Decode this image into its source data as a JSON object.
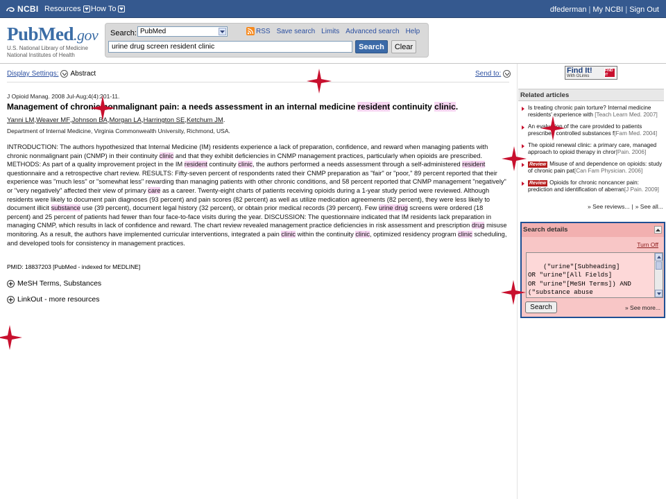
{
  "ncbi": {
    "logo": "NCBI",
    "menu": [
      {
        "label": "Resources"
      },
      {
        "label": "How To"
      }
    ],
    "user": "dfederman",
    "my_ncbi": "My NCBI",
    "sign_out": "Sign Out",
    "separator": "|"
  },
  "header": {
    "logo_main": "PubMed",
    "logo_gov": ".gov",
    "logo_line1": "U.S. National Library of Medicine",
    "logo_line2": "National Institutes of Health",
    "search_label": "Search:",
    "database": "PubMed",
    "links": [
      "RSS",
      "Save search",
      "Limits",
      "Advanced search",
      "Help"
    ],
    "query": "urine drug screen resident clinic",
    "search_button": "Search",
    "clear_button": "Clear"
  },
  "display": {
    "settings_label": "Display Settings:",
    "format": "Abstract",
    "send_to": "Send to:"
  },
  "article": {
    "citation": "J Opioid Manag. 2008 Jul-Aug;4(4):201-11.",
    "title_parts": [
      {
        "text": "Management of chronic nonmalignant pain: a needs assessment in an internal medicine ",
        "hl": false
      },
      {
        "text": "resident",
        "hl": true
      },
      {
        "text": " continuity ",
        "hl": false
      },
      {
        "text": "clinic",
        "hl": true
      },
      {
        "text": ".",
        "hl": false
      }
    ],
    "authors": [
      "Yanni LM",
      "Weaver MF",
      "Johnson BA",
      "Morgan LA",
      "Harrington SE",
      "Ketchum JM"
    ],
    "affiliation": "Department of Internal Medicine, Virginia Commonwealth University, Richmond, USA.",
    "abstract_parts": [
      {
        "text": "INTRODUCTION: The authors hypothesized that Internal Medicine (IM) residents experience a lack of preparation, confidence, and reward when managing patients with chronic nonmalignant pain (CNMP) in their continuity ",
        "hl": false
      },
      {
        "text": "clinic",
        "hl": true
      },
      {
        "text": " and that they exhibit deficiencies in CNMP management practices, particularly when opioids are prescribed. METHODS: As part of a quality improvement project in the IM ",
        "hl": false
      },
      {
        "text": "resident",
        "hl": true
      },
      {
        "text": " continuity ",
        "hl": false
      },
      {
        "text": "clinic",
        "hl": true
      },
      {
        "text": ", the authors performed a needs assessment through a self-administered ",
        "hl": false
      },
      {
        "text": "resident",
        "hl": true
      },
      {
        "text": " questionnaire and a retrospective chart review. RESULTS: Fifty-seven percent of respondents rated their CNMP preparation as \"fair\" or \"poor,\" 89 percent reported that their experience was \"much less\" or \"somewhat less\" rewarding than managing patients with other chronic conditions, and 58 percent reported that CNMP management \"negatively\" or \"very negatively\" affected their view of primary ",
        "hl": false
      },
      {
        "text": "care",
        "hl": true
      },
      {
        "text": " as a career. Twenty-eight charts of patients receiving opioids during a 1-year study period were reviewed. Although residents were likely to document pain diagnoses (93 percent) and pain scores (82 percent) as well as utilize medication agreements (82 percent), they were less likely to document illicit ",
        "hl": false
      },
      {
        "text": "substance",
        "hl": true
      },
      {
        "text": " use (39 percent), document legal history (32 percent), or obtain prior medical records (39 percent). Few ",
        "hl": false
      },
      {
        "text": "urine drug",
        "hl": true
      },
      {
        "text": " screens were ordered (18 percent) and 25 percent of patients had fewer than four face-to-face visits during the year. DISCUSSION: The questionnaire indicated that IM residents lack preparation in managing CNMP, which results in lack of confidence and reward. The chart review revealed management practice deficiencies in risk assessment and prescription ",
        "hl": false
      },
      {
        "text": "drug",
        "hl": true
      },
      {
        "text": " misuse monitoring. As a result, the authors have implemented curricular interventions, integrated a pain ",
        "hl": false
      },
      {
        "text": "clinic",
        "hl": true
      },
      {
        "text": " within the continuity ",
        "hl": false
      },
      {
        "text": "clinic",
        "hl": true
      },
      {
        "text": ", optimized residency program ",
        "hl": false
      },
      {
        "text": "clinic",
        "hl": true
      },
      {
        "text": " scheduling, and developed tools for consistency in management practices.",
        "hl": false
      }
    ],
    "pmid": "PMID: 18837203 [PubMed - indexed for MEDLINE]",
    "mesh_label": "MeSH Terms, Substances",
    "linkout_label": "LinkOut - more resources"
  },
  "sidebar": {
    "findit_main": "Find It!",
    "findit_sub": "With OLinks",
    "findit_badge": "FIND IT",
    "related_title": "Related articles",
    "related": [
      {
        "review": false,
        "text": "Is treating chronic pain torture? Internal medicine residents' experience with ",
        "source": "[Teach Learn Med. 2007]"
      },
      {
        "review": false,
        "text": "An evaluation of the care provided to patients prescribed controlled substances f",
        "source": "[Fam Med. 2004]"
      },
      {
        "review": false,
        "text": "The opioid renewal clinic: a primary care, managed approach to opioid therapy in chror",
        "source": "[Pain. 2006]"
      },
      {
        "review": true,
        "text": "Misuse of and dependence on opioids: study of chronic pain pat",
        "source": "[Can Fam Physician. 2006]"
      },
      {
        "review": true,
        "text": "Opioids for chronic noncancer pain: prediction and identification of aberran",
        "source": "[J Pain. 2009]"
      }
    ],
    "review_badge": "Review",
    "see_reviews": "» See reviews...",
    "see_all": "» See all...",
    "search_details_title": "Search details",
    "turn_off": "Turn Off",
    "search_details_text": "(\"urine\"[Subheading]\nOR \"urine\"[All Fields]\nOR \"urine\"[MeSH Terms]) AND\n(\"substance abuse\ndetection\"[MeSH Terms] OR",
    "search_button": "Search",
    "see_more": "» See more..."
  },
  "colors": {
    "ncbi_bar": "#35598f",
    "highlight": "#f6d6f1",
    "search_details_bg": "#f8c6c6",
    "star": "#c8102e"
  }
}
